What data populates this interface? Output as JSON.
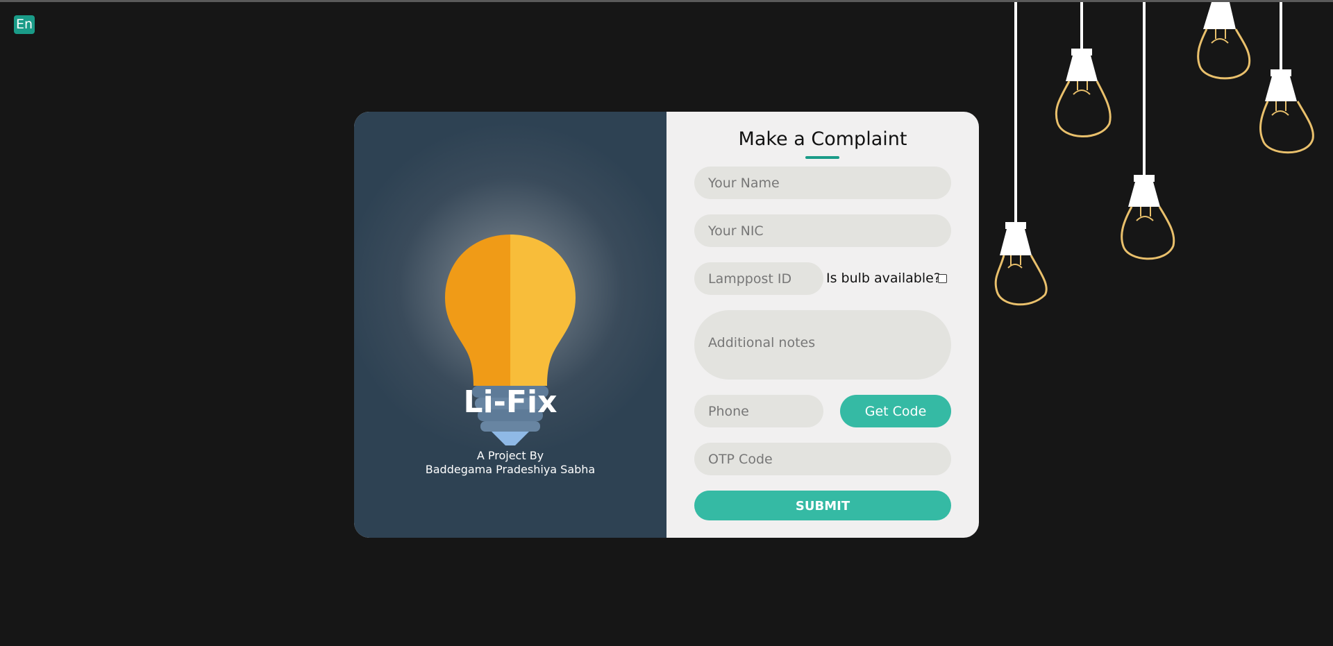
{
  "language_badge": "En",
  "colors": {
    "accent": "#35baa4",
    "accent_dark": "#1a9b88",
    "background": "#161616",
    "panel_left": "#2e4253",
    "panel_right": "#f1f0f0",
    "bulb_orange": "#f09b17",
    "bulb_yellow": "#f8bd3a"
  },
  "brand": {
    "name": "Li-Fix",
    "subtitle_line1": "A Project By",
    "subtitle_line2": "Baddegama Pradeshiya Sabha"
  },
  "form": {
    "title": "Make a Complaint",
    "name_placeholder": "Your Name",
    "nic_placeholder": "Your NIC",
    "lamppost_placeholder": "Lamppost ID",
    "bulb_available_label": "Is bulb available?",
    "bulb_available_checked": false,
    "notes_placeholder": "Additional notes",
    "phone_placeholder": "Phone",
    "get_code_label": "Get Code",
    "otp_placeholder": "OTP Code",
    "submit_label": "SUBMIT"
  },
  "decor": {
    "hanging_lamps_icon": "hanging-bulb-icon",
    "hero_icon": "light-bulb-icon"
  }
}
